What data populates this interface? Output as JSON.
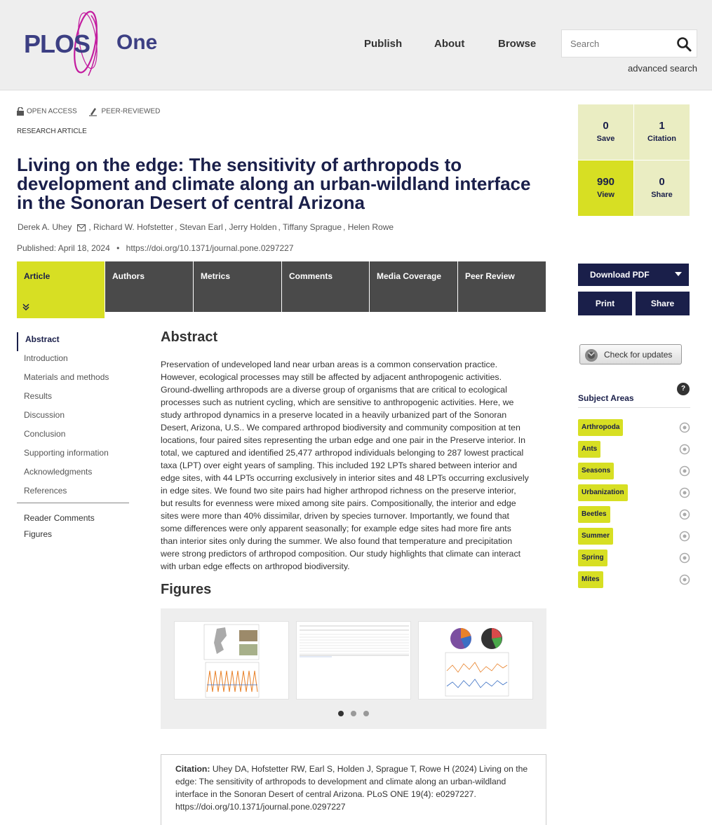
{
  "header": {
    "logo_plos": "PLOS",
    "logo_one": "One",
    "nav": [
      "Publish",
      "About",
      "Browse"
    ],
    "search_placeholder": "Search",
    "advanced_search": "advanced search"
  },
  "badges": {
    "open_access": "OPEN ACCESS",
    "peer_reviewed": "PEER-REVIEWED",
    "article_type": "RESEARCH ARTICLE"
  },
  "article": {
    "title": "Living on the edge: The sensitivity of arthropods to development and climate along an urban-wildland interface in the Sonoran Desert of central Arizona",
    "authors": [
      "Derek A. Uhey",
      "Richard W. Hofstetter",
      "Stevan Earl",
      "Jerry Holden",
      "Tiffany Sprague",
      "Helen Rowe"
    ],
    "published_label": "Published:",
    "published_date": "April 18, 2024",
    "doi": "https://doi.org/10.1371/journal.pone.0297227"
  },
  "tabs": [
    "Article",
    "Authors",
    "Metrics",
    "Comments",
    "Media Coverage",
    "Peer Review"
  ],
  "toc": {
    "items": [
      "Abstract",
      "Introduction",
      "Materials and methods",
      "Results",
      "Discussion",
      "Conclusion",
      "Supporting information",
      "Acknowledgments",
      "References"
    ],
    "extra": [
      "Reader Comments",
      "Figures"
    ]
  },
  "abstract": {
    "heading": "Abstract",
    "lines": [
      "Preservation of undeveloped land near urban areas is a common conservation practice.",
      "However, ecological processes may still be affected by adjacent anthropogenic activities.",
      "Ground-dwelling arthropods are a diverse group of organisms that are critical to ecological",
      "processes such as nutrient cycling, which are sensitive to anthropogenic activities. Here, we",
      "study arthropod dynamics in a preserve located in a heavily urbanized part of the Sonoran",
      "Desert, Arizona, U.S.. We compared arthropod biodiversity and community composition at ten",
      "locations, four paired sites representing the urban edge and one pair in the Preserve interior. In",
      "total, we captured and identified 25,477 arthropod individuals belonging to 287 lowest practical",
      "taxa (LPT) over eight years of sampling. This included 192 LPTs shared between interior and",
      "edge sites, with 44 LPTs occurring exclusively in interior sites and 48 LPTs occurring exclusively",
      "in edge sites. We found two site pairs had higher arthropod richness on the preserve interior,",
      "but results for evenness were mixed among site pairs. Compositionally, the interior and edge",
      "sites were more than 40% dissimilar, driven by species turnover. Importantly, we found that",
      "some differences were only apparent seasonally; for example edge sites had more fire ants",
      "than interior sites only during the summer. We also found that temperature and precipitation",
      "were strong predictors of arthropod composition. Our study highlights that climate can interact",
      "with urban edge effects on arthropod biodiversity."
    ]
  },
  "figures": {
    "heading": "Figures"
  },
  "citation": {
    "label": "Citation:",
    "text": "Uhey DA, Hofstetter RW, Earl S, Holden J, Sprague T, Rowe H (2024) Living on the edge: The sensitivity of arthropods to development and climate along an urban-wildland interface in the Sonoran Desert of central Arizona. PLoS ONE 19(4): e0297227. https://doi.org/10.1371/journal.pone.0297227"
  },
  "metrics": {
    "save": {
      "value": "0",
      "label": "Save"
    },
    "citation": {
      "value": "1",
      "label": "Citation"
    },
    "view": {
      "value": "990",
      "label": "View"
    },
    "share": {
      "value": "0",
      "label": "Share"
    }
  },
  "actions": {
    "download_pdf": "Download PDF",
    "print": "Print",
    "share": "Share",
    "check_updates": "Check for updates"
  },
  "subject_areas": {
    "heading": "Subject Areas",
    "help": "?",
    "items": [
      "Arthropoda",
      "Ants",
      "Seasons",
      "Urbanization",
      "Beetles",
      "Summer",
      "Spring",
      "Mites"
    ]
  },
  "colors": {
    "accent_lime": "#d7df23",
    "navy": "#1a1f4a",
    "tab_gray": "#4a4a4a",
    "logo_magenta": "#c31c9f"
  }
}
